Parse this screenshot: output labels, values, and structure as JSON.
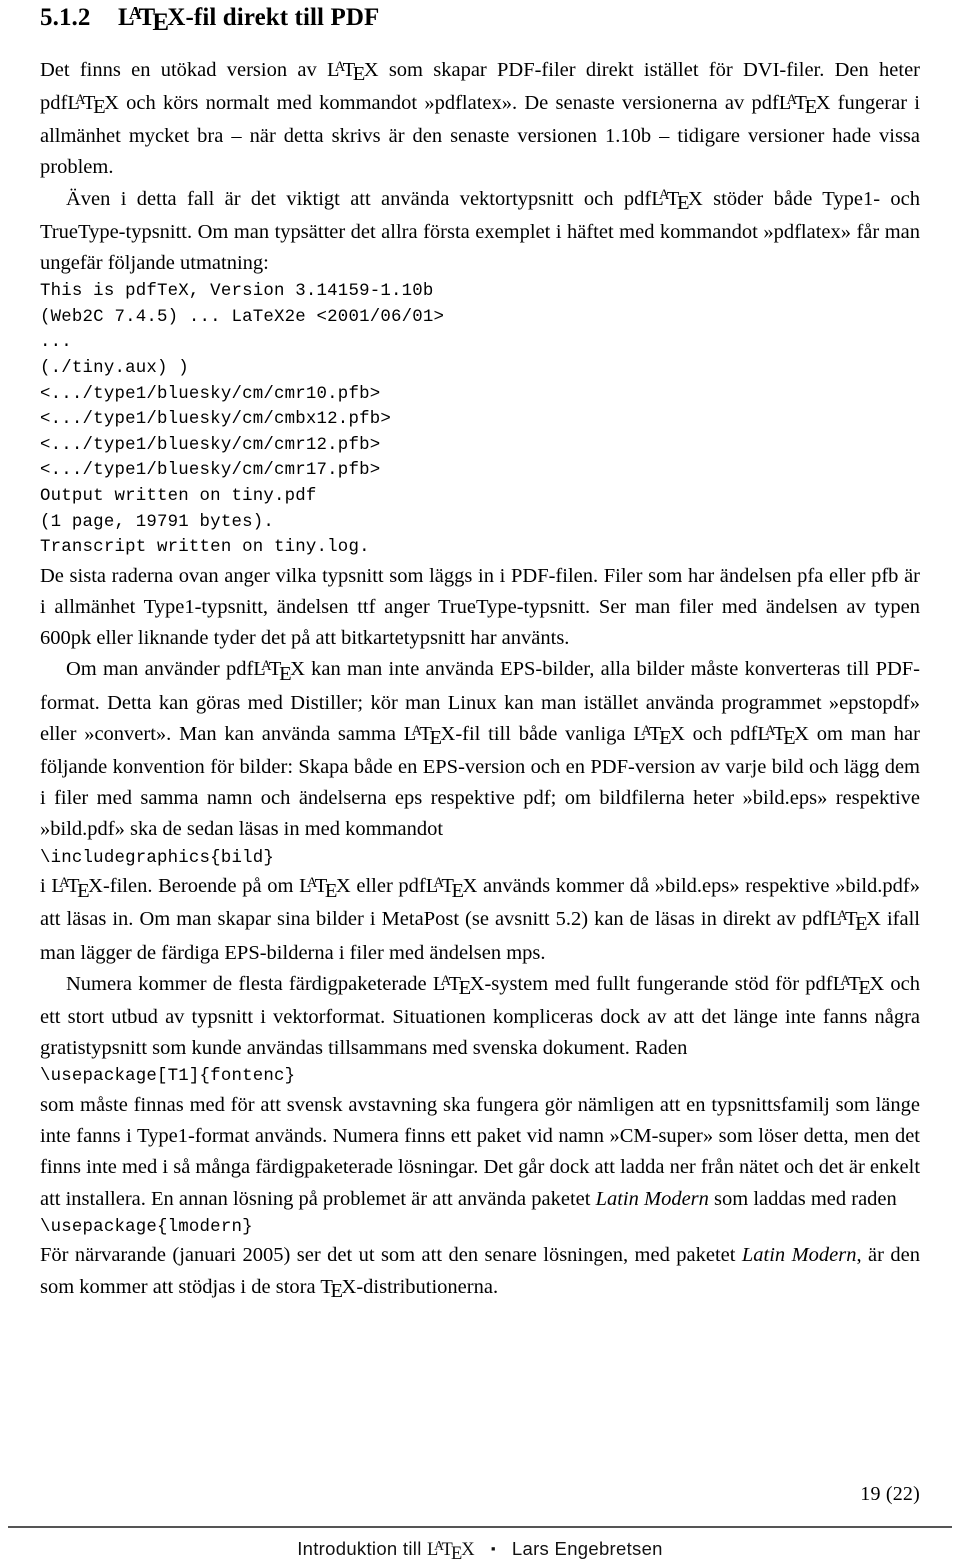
{
  "document": {
    "heading": {
      "number": "5.1.2",
      "title_before": "",
      "title_after": "-fil direkt till PDF",
      "full": "5.1.2 LaTeX-fil direkt till PDF"
    },
    "paragraphs": {
      "p1_a": "Det finns en utökad version av ",
      "p1_b": " som skapar PDF-filer direkt istället för DVI-filer. Den heter pdf",
      "p1_c": " och körs normalt med kommandot »pdflatex». De senaste versionerna av pdf",
      "p1_d": " fungerar i allmänhet mycket bra – när detta skrivs är den senaste versionen 1.10b – tidigare versioner hade vissa problem.",
      "p2_a": "Även i detta fall är det viktigt att använda vektortypsnitt och pdf",
      "p2_b": " stöder både Type1- och TrueType-typsnitt. Om man typsätter det allra första exemplet i häftet med kommandot »pdflatex» får man ungefär följande utmatning:",
      "p3": "De sista raderna ovan anger vilka typsnitt som läggs in i PDF-filen. Filer som har ändelsen pfa eller pfb är i allmänhet Type1-typsnitt, ändelsen ttf anger TrueType-typsnitt. Ser man filer med ändelsen av typen 600pk eller liknande tyder det på att bitkartetypsnitt har använts.",
      "p4_a": "Om man använder pdf",
      "p4_b": " kan man inte använda EPS-bilder, alla bilder måste konverteras till PDF-format. Detta kan göras med Distiller; kör man Linux kan man istället använda programmet »epstopdf» eller »convert». Man kan använda samma ",
      "p4_c": "-fil till både vanliga ",
      "p4_d": " och pdf",
      "p4_e": " om man har följande konvention för bilder: Skapa både en EPS-version och en PDF-version av varje bild och lägg dem i filer med samma namn och ändelserna eps respektive pdf; om bildfilerna heter »bild.eps» respektive »bild.pdf» ska de sedan läsas in med kommandot",
      "p5_a": "i ",
      "p5_b": "-filen. Beroende på om ",
      "p5_c": " eller pdf",
      "p5_d": " används kommer då »bild.eps» respektive »bild.pdf» att läsas in. Om man skapar sina bilder i MetaPost (se avsnitt 5.2) kan de läsas in direkt av pdf",
      "p5_e": " ifall man lägger de färdiga EPS-bilderna i filer med ändelsen mps.",
      "p6_a": "Numera kommer de flesta färdigpaketerade ",
      "p6_b": "-system med fullt fungerande stöd för pdf",
      "p6_c": " och ett stort utbud av typsnitt i vektorformat. Situationen kompliceras dock av att det länge inte fanns några gratistypsnitt som kunde användas tillsammans med svenska dokument. Raden",
      "p7_a": "som måste finnas med för att svensk avstavning ska fungera gör nämligen att en typsnittsfamilj som länge inte fanns i Type1-format används. Numera finns ett paket vid namn »CM-super» som löser detta, men det finns inte med i så många färdigpaketerade lösningar. Det går dock att ladda ner från nätet och det är enkelt att installera. En annan lösning på problemet är att använda paketet ",
      "p7_italic": "Latin Modern",
      "p7_b": " som laddas med raden",
      "p8_a": "För närvarande (januari 2005) ser det ut som att den senare lösningen, med paketet ",
      "p8_italic": "Latin Modern",
      "p8_b": ", är den som kommer att stödjas i de stora ",
      "p8_c": "-distributionerna."
    },
    "code_blocks": {
      "output_log": "This is pdfTeX, Version 3.14159-1.10b\n(Web2C 7.4.5) ... LaTeX2e <2001/06/01>\n...\n(./tiny.aux) )\n<.../type1/bluesky/cm/cmr10.pfb>\n<.../type1/bluesky/cm/cmbx12.pfb>\n<.../type1/bluesky/cm/cmr12.pfb>\n<.../type1/bluesky/cm/cmr17.pfb>\nOutput written on tiny.pdf\n(1 page, 19791 bytes).\nTranscript written on tiny.log.",
      "includegraphics": "\\includegraphics{bild}",
      "fontenc": "\\usepackage[T1]{fontenc}",
      "lmodern": "\\usepackage{lmodern}"
    },
    "logos": {
      "latex_l": "L",
      "latex_a": "A",
      "latex_t": "T",
      "latex_e": "E",
      "latex_x": "X",
      "tex_t": "T",
      "tex_e": "E",
      "tex_x": "X"
    },
    "footer": {
      "page_number": "19 (22)",
      "title_before": "Introduktion till ",
      "separator": "▪",
      "author": "Lars Engebretsen"
    }
  }
}
